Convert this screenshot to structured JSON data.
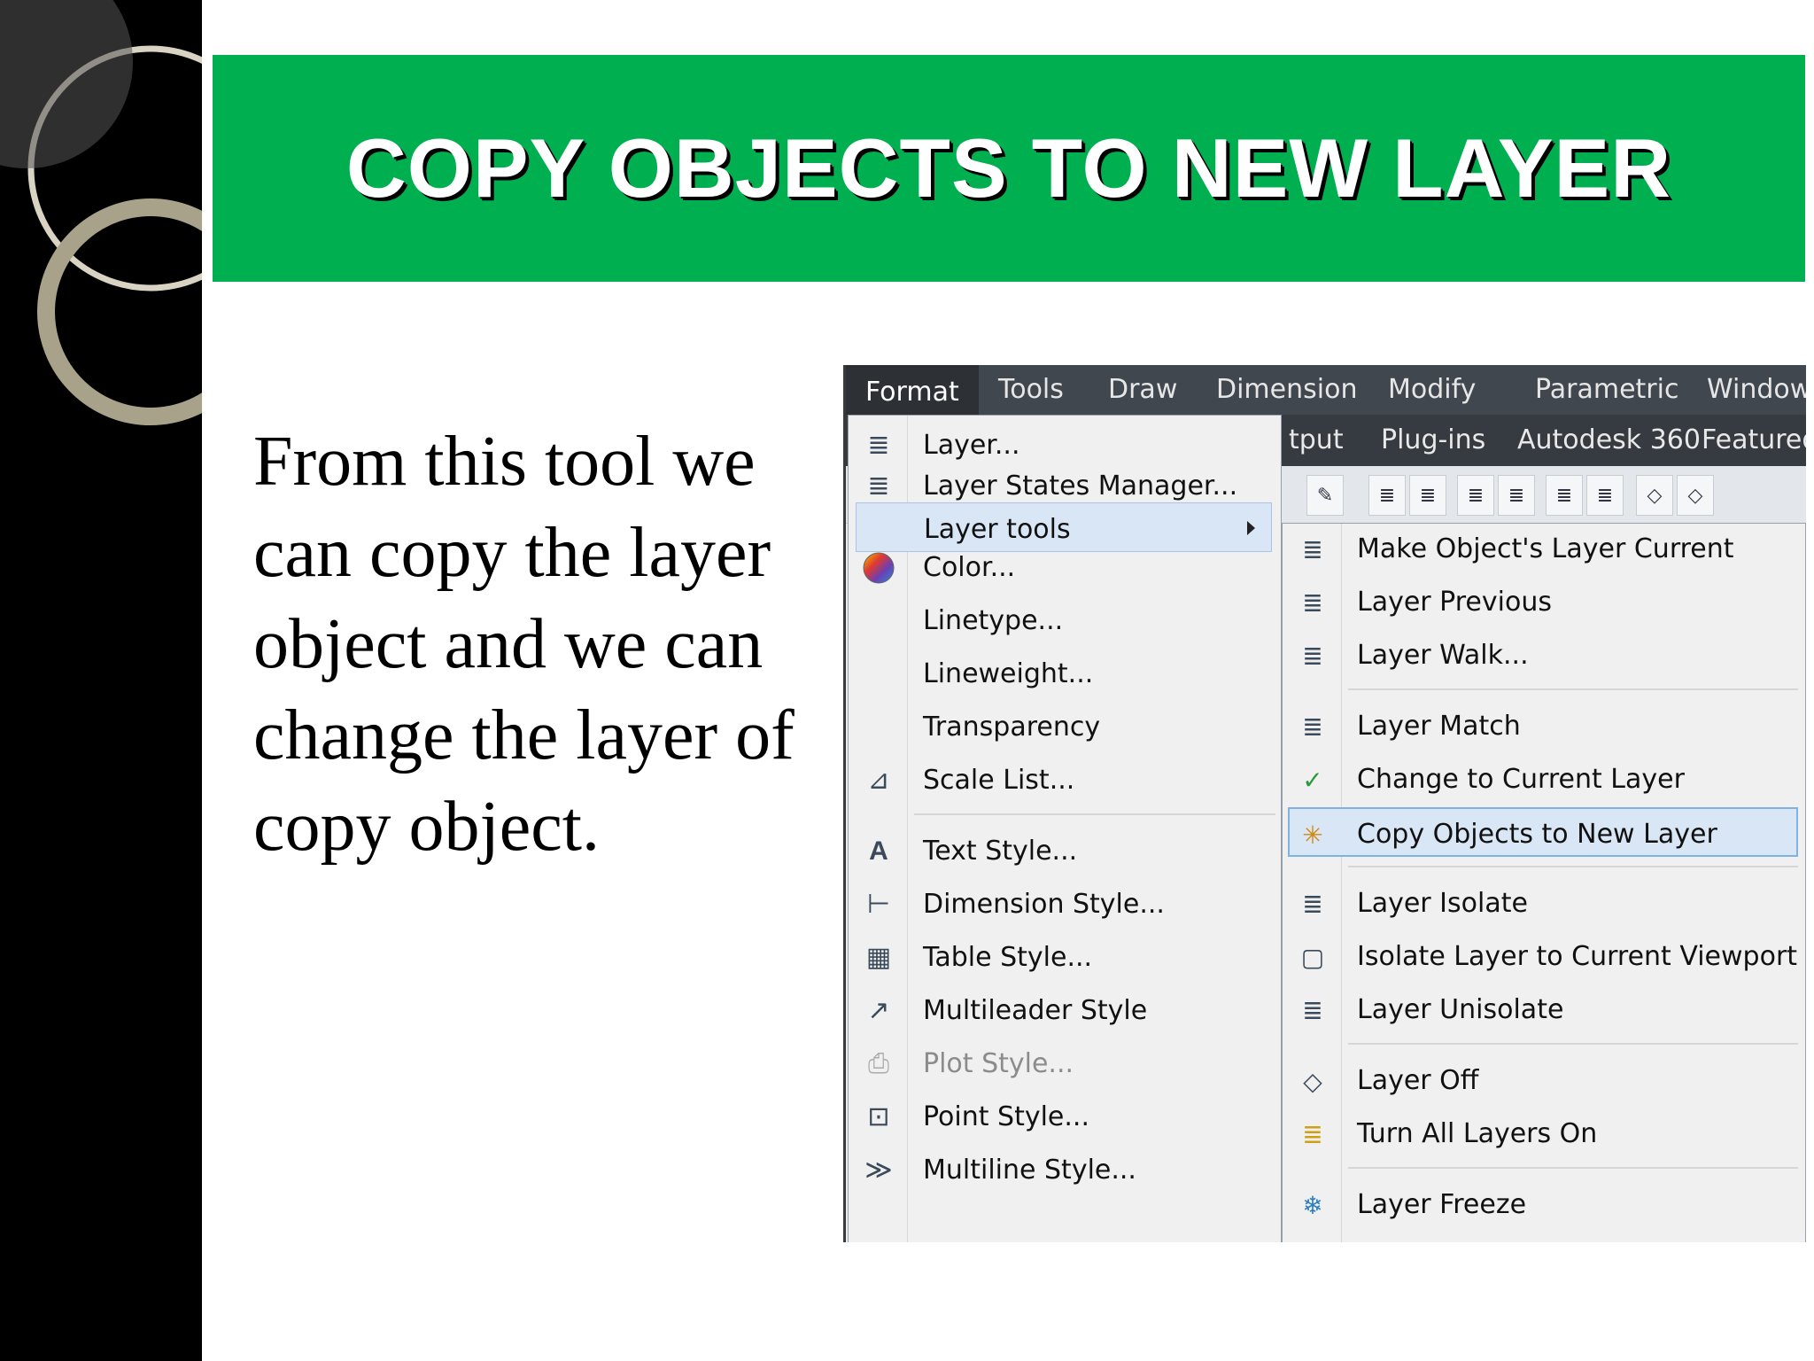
{
  "slide": {
    "title": "COPY OBJECTS TO NEW LAYER",
    "body": "From this tool we can copy the layer object and we can change the layer of copy object."
  },
  "menubar": {
    "items": [
      "Format",
      "Tools",
      "Draw",
      "Dimension",
      "Modify",
      "Parametric",
      "Window"
    ]
  },
  "ribbon_tabs": {
    "items": [
      "tput",
      "Plug-ins",
      "Autodesk 360",
      "Featured"
    ]
  },
  "format_menu": {
    "items": [
      {
        "label": "Layer...",
        "icon": "layer-icon"
      },
      {
        "label": "Layer States Manager...",
        "icon": "layer-states-icon"
      },
      {
        "label": "Layer tools",
        "icon": "",
        "highlighted": true,
        "submenu": true
      },
      {
        "label": "Color...",
        "icon": "color-wheel-icon"
      },
      {
        "label": "Linetype...",
        "icon": ""
      },
      {
        "label": "Lineweight...",
        "icon": ""
      },
      {
        "label": "Transparency",
        "icon": ""
      },
      {
        "label": "Scale List...",
        "icon": "scale-list-icon"
      },
      {
        "label": "Text Style...",
        "icon": "text-style-icon"
      },
      {
        "label": "Dimension Style...",
        "icon": "dimension-style-icon"
      },
      {
        "label": "Table Style...",
        "icon": "table-style-icon"
      },
      {
        "label": "Multileader Style",
        "icon": "multileader-style-icon"
      },
      {
        "label": "Plot Style...",
        "icon": "plot-style-icon",
        "disabled": true
      },
      {
        "label": "Point Style...",
        "icon": "point-style-icon"
      },
      {
        "label": "Multiline Style...",
        "icon": "multiline-style-icon"
      }
    ]
  },
  "layer_tools_submenu": {
    "items": [
      {
        "label": "Make Object's Layer Current",
        "icon": "make-current-icon"
      },
      {
        "label": "Layer Previous",
        "icon": "layer-previous-icon"
      },
      {
        "label": "Layer Walk...",
        "icon": "layer-walk-icon"
      },
      {
        "label": "Layer Match",
        "icon": "layer-match-icon"
      },
      {
        "label": "Change to Current Layer",
        "icon": "change-current-icon"
      },
      {
        "label": "Copy Objects to New Layer",
        "icon": "copy-objects-icon",
        "highlighted": true
      },
      {
        "label": "Layer Isolate",
        "icon": "layer-isolate-icon"
      },
      {
        "label": "Isolate Layer to Current Viewport",
        "icon": "isolate-viewport-icon"
      },
      {
        "label": "Layer Unisolate",
        "icon": "layer-unisolate-icon"
      },
      {
        "label": "Layer Off",
        "icon": "layer-off-icon"
      },
      {
        "label": "Turn All Layers On",
        "icon": "layers-on-icon"
      },
      {
        "label": "Layer Freeze",
        "icon": "layer-freeze-icon"
      }
    ]
  },
  "colors": {
    "banner": "#00b050",
    "highlight": "#d8e6f5",
    "menubar": "#41474f"
  }
}
